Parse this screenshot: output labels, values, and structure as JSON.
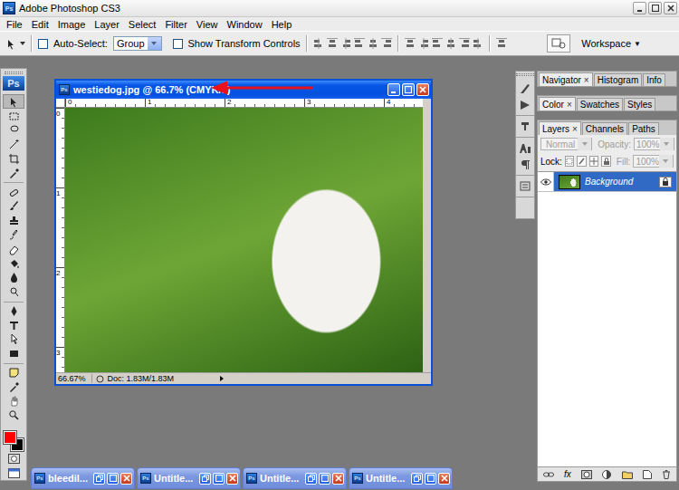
{
  "app": {
    "title": "Adobe Photoshop CS3",
    "logo": "Ps"
  },
  "menu": [
    "File",
    "Edit",
    "Image",
    "Layer",
    "Select",
    "Filter",
    "View",
    "Window",
    "Help"
  ],
  "options_bar": {
    "auto_select": {
      "label": "Auto-Select:",
      "checked": false
    },
    "auto_select_target": "Group",
    "transform_controls": {
      "label": "Show Transform Controls",
      "checked": false
    },
    "workspace": {
      "label": "Workspace",
      "arrow": "▼"
    }
  },
  "toolbox": {
    "foreground_color": "#ff0000",
    "background_color": "#000000"
  },
  "document": {
    "title": "westiedog.jpg @ 66.7% (CMYK/8)",
    "active": true,
    "ruler_top": [
      "0",
      "1",
      "2",
      "3",
      "4"
    ],
    "ruler_left": [
      "0",
      "1",
      "2",
      "3"
    ],
    "zoom": "66.67%",
    "doc_size": "Doc: 1.83M/1.83M"
  },
  "panel_groups": [
    {
      "tabs": [
        {
          "label": "Navigator",
          "selected": true,
          "close": "×"
        },
        {
          "label": "Histogram",
          "selected": false
        },
        {
          "label": "Info",
          "selected": false
        }
      ]
    },
    {
      "tabs": [
        {
          "label": "Color",
          "selected": true,
          "close": "×"
        },
        {
          "label": "Swatches",
          "selected": false
        },
        {
          "label": "Styles",
          "selected": false
        }
      ]
    },
    {
      "tabs": [
        {
          "label": "Layers",
          "selected": true,
          "close": "×"
        },
        {
          "label": "Channels",
          "selected": false
        },
        {
          "label": "Paths",
          "selected": false
        }
      ]
    }
  ],
  "layers": {
    "blend_mode": {
      "value": "Normal",
      "disabled": true
    },
    "opacity": {
      "label": "Opacity:",
      "value": "100%",
      "disabled": true
    },
    "lock_label": "Lock:",
    "fill": {
      "label": "Fill:",
      "value": "100%",
      "disabled": true
    },
    "items": [
      {
        "name": "Background",
        "visible": true,
        "selected": true,
        "locked": true
      }
    ],
    "fx_label": "fx"
  },
  "minimized_windows": [
    {
      "title": "bleedil..."
    },
    {
      "title": "Untitle..."
    },
    {
      "title": "Untitle..."
    },
    {
      "title": "Untitle..."
    }
  ]
}
